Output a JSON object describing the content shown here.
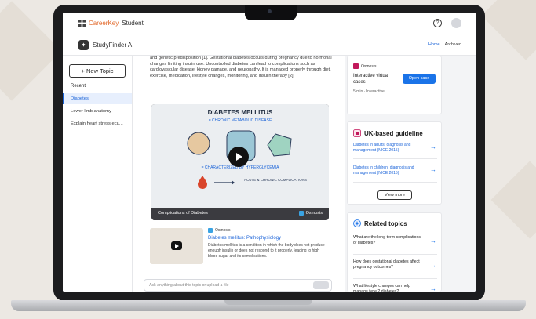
{
  "topbar": {
    "brand_prefix": "",
    "brand_name": "CareerKey",
    "brand_suffix": "Student",
    "help_glyph": "?",
    "avatar_initials": ""
  },
  "appbar": {
    "logo_glyph": "✦",
    "app_name": "StudyFinder AI",
    "link_active": "Home",
    "link_other": "Archived"
  },
  "sidebar": {
    "new_topic": "+ New Topic",
    "heading": "Recent",
    "items": [
      {
        "label": "Diabetes"
      },
      {
        "label": "Lower limb anatomy"
      },
      {
        "label": "Explain heart stress ecu..."
      }
    ]
  },
  "main": {
    "paragraph": "and genetic predisposition [1]. Gestational diabetes occurs during pregnancy due to hormonal changes limiting insulin use. Uncontrolled diabetes can lead to complications such as cardiovascular disease, kidney damage, and neuropathy. It is managed properly through diet, exercise, medication, lifestyle changes, monitoring, and insulin therapy [2].",
    "video": {
      "title": "DIABETES MELLITUS",
      "subtitle": "= CHRONIC METABOLIC DISEASE",
      "subtitle2": "= CHARACTERIZED BY HYPERGLYCEMIA",
      "label_right": "ACUTE & CHRONIC COMPLICATIONS",
      "caption": "Complications of Diabetes",
      "source": "Osmosis"
    },
    "card2": {
      "source": "Osmosis",
      "title": "Diabetes mellitus: Pathophysiology",
      "text": "Diabetes mellitus is a condition in which the body does not produce enough insulin or does not respond to it properly, leading to high blood sugar and its complications."
    },
    "input_placeholder": "Ask anything about this topic or upload a file"
  },
  "right": {
    "card1": {
      "tag": "Osmosis",
      "title": "Interactive virtual cases",
      "sub": "5 min · Interactive",
      "button": "Open case"
    },
    "card2": {
      "heading": "UK-based guideline",
      "links": [
        "Diabetes in adults: diagnosis and management (NICE 2015)",
        "Diabetes in children: diagnosis and management (NICE 2015)"
      ],
      "button": "View more"
    },
    "card3": {
      "heading": "Related topics",
      "questions": [
        "What are the long-term complications of diabetes?",
        "How does gestational diabetes affect pregnancy outcomes?",
        "What lifestyle changes can help manage type 2 diabetes?"
      ]
    }
  },
  "colors": {
    "accent": "#1a73e8",
    "brand_orange": "#e2692b",
    "active_bg": "#e7effd"
  }
}
